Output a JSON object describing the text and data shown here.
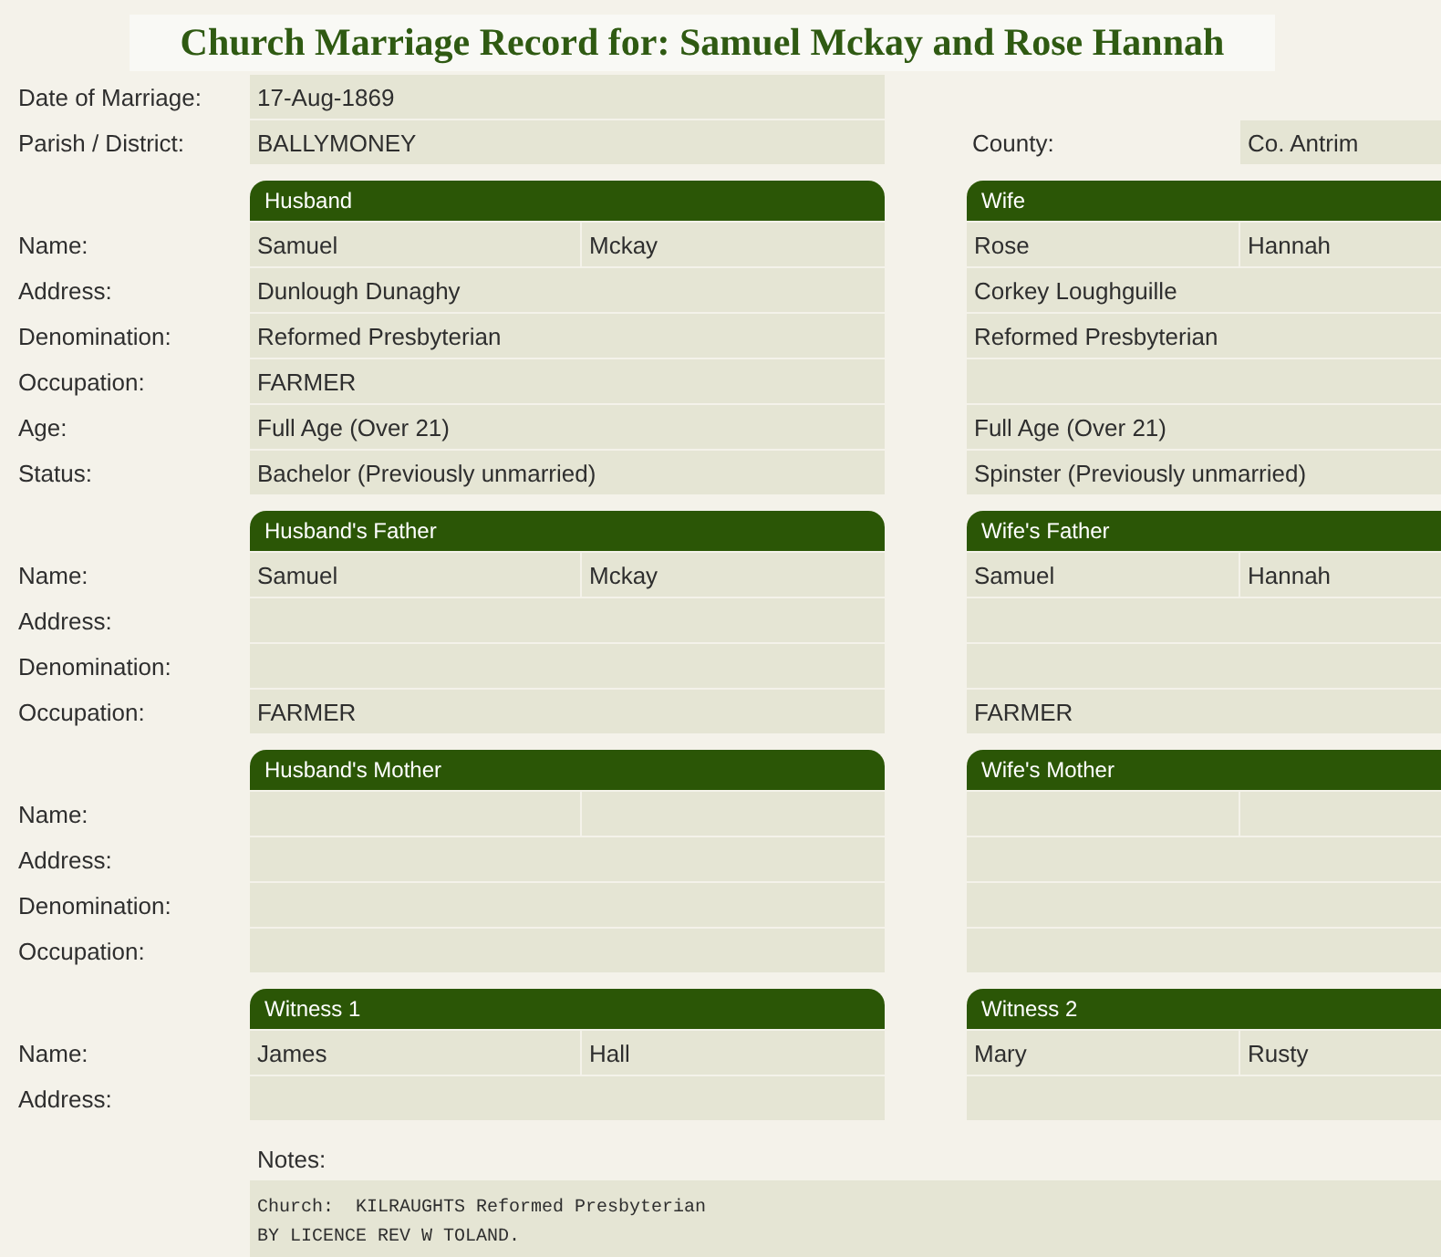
{
  "title": "Church Marriage Record for: Samuel Mckay and Rose Hannah",
  "date": {
    "label": "Date of Marriage:",
    "value": "17-Aug-1869"
  },
  "parish": {
    "label": "Parish / District:",
    "value": "BALLYMONEY"
  },
  "county": {
    "label": "County:",
    "value": "Co. Antrim"
  },
  "sections": [
    {
      "left_title": "Husband",
      "right_title": "Wife",
      "rows": [
        {
          "label": "Name:",
          "kind": "split",
          "left": {
            "first": "Samuel",
            "second": "Mckay"
          },
          "right": {
            "first": "Rose",
            "second": "Hannah"
          }
        },
        {
          "label": "Address:",
          "kind": "full",
          "left": {
            "first": "Dunlough Dunaghy"
          },
          "right": {
            "first": "Corkey Loughguille"
          }
        },
        {
          "label": "Denomination:",
          "kind": "full",
          "left": {
            "first": "Reformed Presbyterian"
          },
          "right": {
            "first": "Reformed Presbyterian"
          }
        },
        {
          "label": "Occupation:",
          "kind": "full",
          "left": {
            "first": "FARMER"
          }
        },
        {
          "label": "Age:",
          "kind": "full",
          "left": {
            "first": "Full Age (Over 21)"
          },
          "right": {
            "first": "Full Age (Over 21)"
          }
        },
        {
          "label": "Status:",
          "kind": "full",
          "left": {
            "first": "Bachelor (Previously unmarried)"
          },
          "right": {
            "first": "Spinster (Previously unmarried)"
          }
        }
      ]
    },
    {
      "left_title": "Husband's Father",
      "right_title": "Wife's Father",
      "rows": [
        {
          "label": "Name:",
          "kind": "split",
          "left": {
            "first": "Samuel",
            "second": "Mckay"
          },
          "right": {
            "first": "Samuel",
            "second": "Hannah"
          }
        },
        {
          "label": "Address:",
          "kind": "full"
        },
        {
          "label": "Denomination:",
          "kind": "full"
        },
        {
          "label": "Occupation:",
          "kind": "full",
          "left": {
            "first": "FARMER"
          },
          "right": {
            "first": "FARMER"
          }
        }
      ]
    },
    {
      "left_title": "Husband's Mother",
      "right_title": "Wife's Mother",
      "rows": [
        {
          "label": "Name:",
          "kind": "split"
        },
        {
          "label": "Address:",
          "kind": "full"
        },
        {
          "label": "Denomination:",
          "kind": "full"
        },
        {
          "label": "Occupation:",
          "kind": "full"
        }
      ]
    },
    {
      "left_title": "Witness 1",
      "right_title": "Witness 2",
      "rows": [
        {
          "label": "Name:",
          "kind": "split",
          "left": {
            "first": "James",
            "second": "Hall"
          },
          "right": {
            "first": "Mary",
            "second": "Rusty"
          }
        },
        {
          "label": "Address:",
          "kind": "full"
        }
      ]
    }
  ],
  "notes": {
    "label": "Notes:",
    "lines": [
      "Church:  KILRAUGHTS Reformed Presbyterian",
      "BY LICENCE REV W TOLAND."
    ]
  }
}
